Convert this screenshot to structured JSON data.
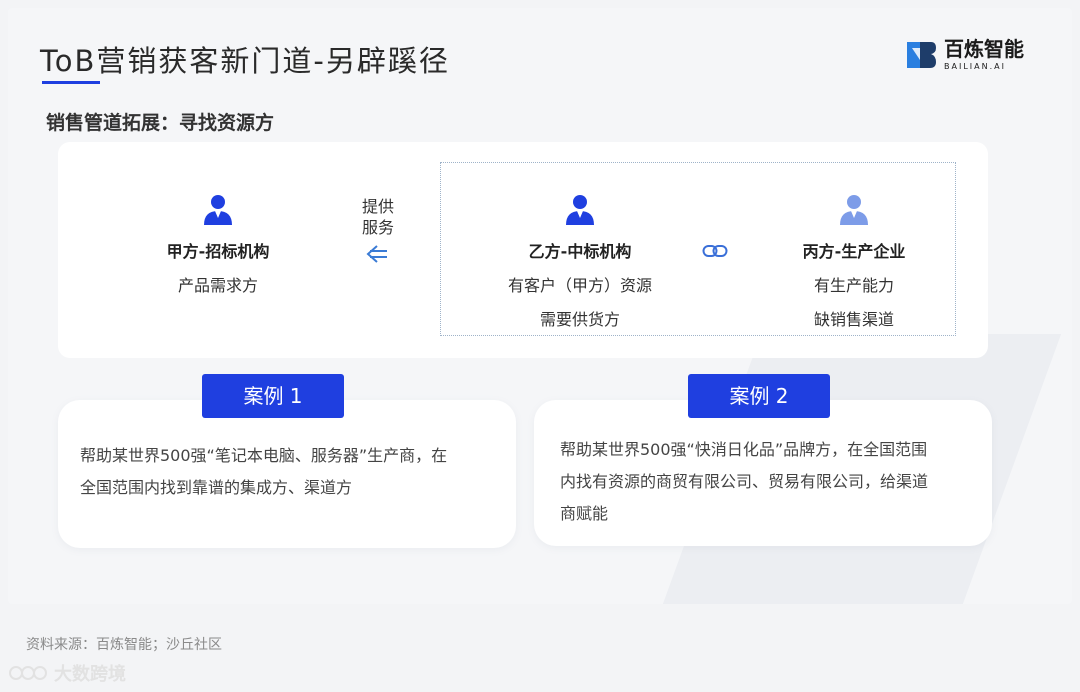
{
  "header": {
    "title": "ToB营销获客新门道-另辟蹊径",
    "logo_main": "百炼智能",
    "logo_sub": "BAILIAN.AI"
  },
  "subtitle": "销售管道拓展：寻找资源方",
  "diagram": {
    "party_a": {
      "name": "甲方-招标机构",
      "lines": [
        "产品需求方"
      ]
    },
    "provide_label_1": "提供",
    "provide_label_2": "服务",
    "party_b": {
      "name": "乙方-中标机构",
      "lines": [
        "有客户（甲方）资源",
        "需要供货方"
      ]
    },
    "party_c": {
      "name": "丙方-生产企业",
      "lines": [
        "有生产能力",
        "缺销售渠道"
      ]
    }
  },
  "cases": [
    {
      "label": "案例 1",
      "text_1": "帮助某世界500强“笔记本电脑、服务器”生产商，在",
      "text_2": "全国范围内找到靠谱的集成方、渠道方"
    },
    {
      "label": "案例 2",
      "text_1": "帮助某世界500强“快消日化品”品牌方，在全国范围",
      "text_2": "内找有资源的商贸有限公司、贸易有限公司，给渠道",
      "text_3": "商赋能"
    }
  ],
  "footer": {
    "source": "资料来源：百炼智能；沙丘社区",
    "watermark": "大数跨境"
  },
  "colors": {
    "accent": "#1f3fe0",
    "person_dark": "#1f3fe0",
    "person_light": "#7d9ce8"
  },
  "icons": [
    "person-icon",
    "arrow-left-icon",
    "link-icon",
    "logo-icon"
  ]
}
